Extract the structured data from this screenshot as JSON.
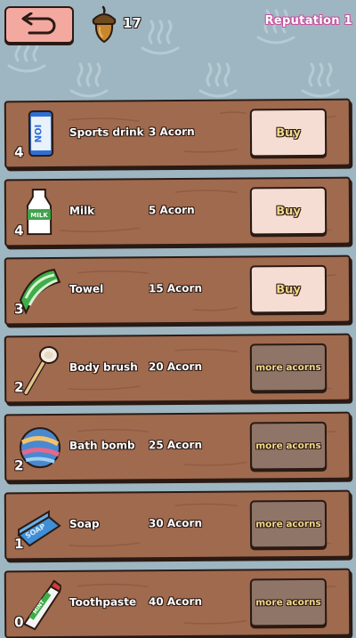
{
  "colors": {
    "background": "#9db6c1",
    "wood": "#a06a4e",
    "buy_button": "#f6ddd3",
    "more_button": "#8f7567",
    "reputation": "#c94fa0"
  },
  "header": {
    "back_icon": "back-arrow-icon",
    "acorn_icon": "acorn-icon",
    "acorn_count": "17",
    "reputation": "Reputation 1"
  },
  "items": [
    {
      "icon": "sports-drink-icon",
      "qty": "4",
      "name": "Sports drink",
      "price": "3 Acorn",
      "action": "Buy"
    },
    {
      "icon": "milk-icon",
      "qty": "4",
      "name": "Milk",
      "price": "5 Acorn",
      "action": "Buy"
    },
    {
      "icon": "towel-icon",
      "qty": "3",
      "name": "Towel",
      "price": "15 Acorn",
      "action": "Buy"
    },
    {
      "icon": "body-brush-icon",
      "qty": "2",
      "name": "Body brush",
      "price": "20 Acorn",
      "action": "more acorns"
    },
    {
      "icon": "bath-bomb-icon",
      "qty": "2",
      "name": "Bath bomb",
      "price": "25 Acorn",
      "action": "more acorns"
    },
    {
      "icon": "soap-icon",
      "qty": "1",
      "name": "Soap",
      "price": "30 Acorn",
      "action": "more acorns"
    },
    {
      "icon": "toothpaste-icon",
      "qty": "0",
      "name": "Toothpaste",
      "price": "40 Acorn",
      "action": "more acorns"
    }
  ]
}
